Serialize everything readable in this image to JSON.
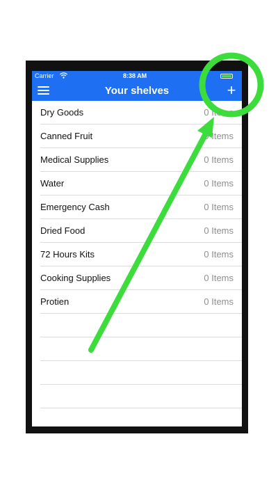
{
  "status_bar": {
    "carrier": "Carrier",
    "time": "8:38 AM",
    "battery_color": "#4cd964"
  },
  "nav_bar": {
    "title": "Your shelves",
    "menu_icon": "hamburger-menu-icon",
    "add_label": "+",
    "background_color": "#1e6ff2"
  },
  "shelves": [
    {
      "name": "Dry Goods",
      "count": "0 Items"
    },
    {
      "name": "Canned Fruit",
      "count": "0 Items"
    },
    {
      "name": "Medical Supplies",
      "count": "0 Items"
    },
    {
      "name": "Water",
      "count": "0 Items"
    },
    {
      "name": "Emergency Cash",
      "count": "0 Items"
    },
    {
      "name": "Dried Food",
      "count": "0 Items"
    },
    {
      "name": "72 Hours Kits",
      "count": "0 Items"
    },
    {
      "name": "Cooking Supplies",
      "count": "0 Items"
    },
    {
      "name": "Protien",
      "count": "0 Items"
    }
  ],
  "annotation": {
    "color": "#3ddc3d",
    "shapes": [
      "circle",
      "arrow"
    ]
  }
}
